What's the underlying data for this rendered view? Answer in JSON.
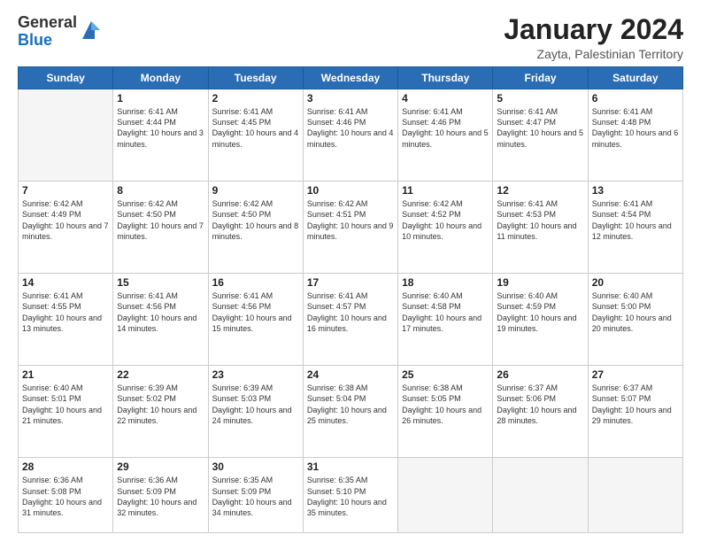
{
  "logo": {
    "general": "General",
    "blue": "Blue"
  },
  "title": "January 2024",
  "location": "Zayta, Palestinian Territory",
  "days_of_week": [
    "Sunday",
    "Monday",
    "Tuesday",
    "Wednesday",
    "Thursday",
    "Friday",
    "Saturday"
  ],
  "weeks": [
    [
      {
        "day": "",
        "info": ""
      },
      {
        "day": "1",
        "info": "Sunrise: 6:41 AM\nSunset: 4:44 PM\nDaylight: 10 hours\nand 3 minutes."
      },
      {
        "day": "2",
        "info": "Sunrise: 6:41 AM\nSunset: 4:45 PM\nDaylight: 10 hours\nand 4 minutes."
      },
      {
        "day": "3",
        "info": "Sunrise: 6:41 AM\nSunset: 4:46 PM\nDaylight: 10 hours\nand 4 minutes."
      },
      {
        "day": "4",
        "info": "Sunrise: 6:41 AM\nSunset: 4:46 PM\nDaylight: 10 hours\nand 5 minutes."
      },
      {
        "day": "5",
        "info": "Sunrise: 6:41 AM\nSunset: 4:47 PM\nDaylight: 10 hours\nand 5 minutes."
      },
      {
        "day": "6",
        "info": "Sunrise: 6:41 AM\nSunset: 4:48 PM\nDaylight: 10 hours\nand 6 minutes."
      }
    ],
    [
      {
        "day": "7",
        "info": "Sunrise: 6:42 AM\nSunset: 4:49 PM\nDaylight: 10 hours\nand 7 minutes."
      },
      {
        "day": "8",
        "info": "Sunrise: 6:42 AM\nSunset: 4:50 PM\nDaylight: 10 hours\nand 7 minutes."
      },
      {
        "day": "9",
        "info": "Sunrise: 6:42 AM\nSunset: 4:50 PM\nDaylight: 10 hours\nand 8 minutes."
      },
      {
        "day": "10",
        "info": "Sunrise: 6:42 AM\nSunset: 4:51 PM\nDaylight: 10 hours\nand 9 minutes."
      },
      {
        "day": "11",
        "info": "Sunrise: 6:42 AM\nSunset: 4:52 PM\nDaylight: 10 hours\nand 10 minutes."
      },
      {
        "day": "12",
        "info": "Sunrise: 6:41 AM\nSunset: 4:53 PM\nDaylight: 10 hours\nand 11 minutes."
      },
      {
        "day": "13",
        "info": "Sunrise: 6:41 AM\nSunset: 4:54 PM\nDaylight: 10 hours\nand 12 minutes."
      }
    ],
    [
      {
        "day": "14",
        "info": "Sunrise: 6:41 AM\nSunset: 4:55 PM\nDaylight: 10 hours\nand 13 minutes."
      },
      {
        "day": "15",
        "info": "Sunrise: 6:41 AM\nSunset: 4:56 PM\nDaylight: 10 hours\nand 14 minutes."
      },
      {
        "day": "16",
        "info": "Sunrise: 6:41 AM\nSunset: 4:56 PM\nDaylight: 10 hours\nand 15 minutes."
      },
      {
        "day": "17",
        "info": "Sunrise: 6:41 AM\nSunset: 4:57 PM\nDaylight: 10 hours\nand 16 minutes."
      },
      {
        "day": "18",
        "info": "Sunrise: 6:40 AM\nSunset: 4:58 PM\nDaylight: 10 hours\nand 17 minutes."
      },
      {
        "day": "19",
        "info": "Sunrise: 6:40 AM\nSunset: 4:59 PM\nDaylight: 10 hours\nand 19 minutes."
      },
      {
        "day": "20",
        "info": "Sunrise: 6:40 AM\nSunset: 5:00 PM\nDaylight: 10 hours\nand 20 minutes."
      }
    ],
    [
      {
        "day": "21",
        "info": "Sunrise: 6:40 AM\nSunset: 5:01 PM\nDaylight: 10 hours\nand 21 minutes."
      },
      {
        "day": "22",
        "info": "Sunrise: 6:39 AM\nSunset: 5:02 PM\nDaylight: 10 hours\nand 22 minutes."
      },
      {
        "day": "23",
        "info": "Sunrise: 6:39 AM\nSunset: 5:03 PM\nDaylight: 10 hours\nand 24 minutes."
      },
      {
        "day": "24",
        "info": "Sunrise: 6:38 AM\nSunset: 5:04 PM\nDaylight: 10 hours\nand 25 minutes."
      },
      {
        "day": "25",
        "info": "Sunrise: 6:38 AM\nSunset: 5:05 PM\nDaylight: 10 hours\nand 26 minutes."
      },
      {
        "day": "26",
        "info": "Sunrise: 6:37 AM\nSunset: 5:06 PM\nDaylight: 10 hours\nand 28 minutes."
      },
      {
        "day": "27",
        "info": "Sunrise: 6:37 AM\nSunset: 5:07 PM\nDaylight: 10 hours\nand 29 minutes."
      }
    ],
    [
      {
        "day": "28",
        "info": "Sunrise: 6:36 AM\nSunset: 5:08 PM\nDaylight: 10 hours\nand 31 minutes."
      },
      {
        "day": "29",
        "info": "Sunrise: 6:36 AM\nSunset: 5:09 PM\nDaylight: 10 hours\nand 32 minutes."
      },
      {
        "day": "30",
        "info": "Sunrise: 6:35 AM\nSunset: 5:09 PM\nDaylight: 10 hours\nand 34 minutes."
      },
      {
        "day": "31",
        "info": "Sunrise: 6:35 AM\nSunset: 5:10 PM\nDaylight: 10 hours\nand 35 minutes."
      },
      {
        "day": "",
        "info": ""
      },
      {
        "day": "",
        "info": ""
      },
      {
        "day": "",
        "info": ""
      }
    ]
  ]
}
